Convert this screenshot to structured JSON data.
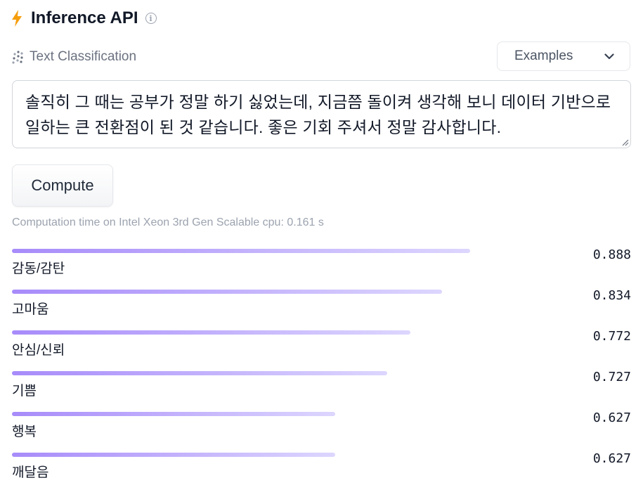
{
  "header": {
    "title": "Inference API",
    "info_glyph": "i"
  },
  "task": {
    "label": "Text Classification"
  },
  "examples": {
    "label": "Examples"
  },
  "input": {
    "text": "솔직히 그 때는 공부가 정말 하기 싫었는데, 지금쯤 돌이켜 생각해 보니 데이터 기반으로 일하는 큰 전환점이 된 것 같습니다. 좋은 기회 주셔서 정말 감사합니다."
  },
  "compute": {
    "label": "Compute"
  },
  "computation_time": "Computation time on Intel Xeon 3rd Gen Scalable cpu: 0.161 s",
  "results": [
    {
      "label": "감동/감탄",
      "score": "0.888",
      "value": 0.888
    },
    {
      "label": "고마움",
      "score": "0.834",
      "value": 0.834
    },
    {
      "label": "안심/신뢰",
      "score": "0.772",
      "value": 0.772
    },
    {
      "label": "기쁨",
      "score": "0.727",
      "value": 0.727
    },
    {
      "label": "행복",
      "score": "0.627",
      "value": 0.627
    },
    {
      "label": "깨달음",
      "score": "0.627",
      "value": 0.627
    }
  ],
  "colors": {
    "accent": "#f59e0b",
    "bar_start": "#a78bfa",
    "bar_end": "#ddd6fe",
    "muted": "#9ca3af"
  },
  "icons": {
    "bolt": "lightning-bolt-icon",
    "info": "info-icon",
    "task": "dots-grid-icon",
    "dropdown": "chevron-down-icon"
  }
}
